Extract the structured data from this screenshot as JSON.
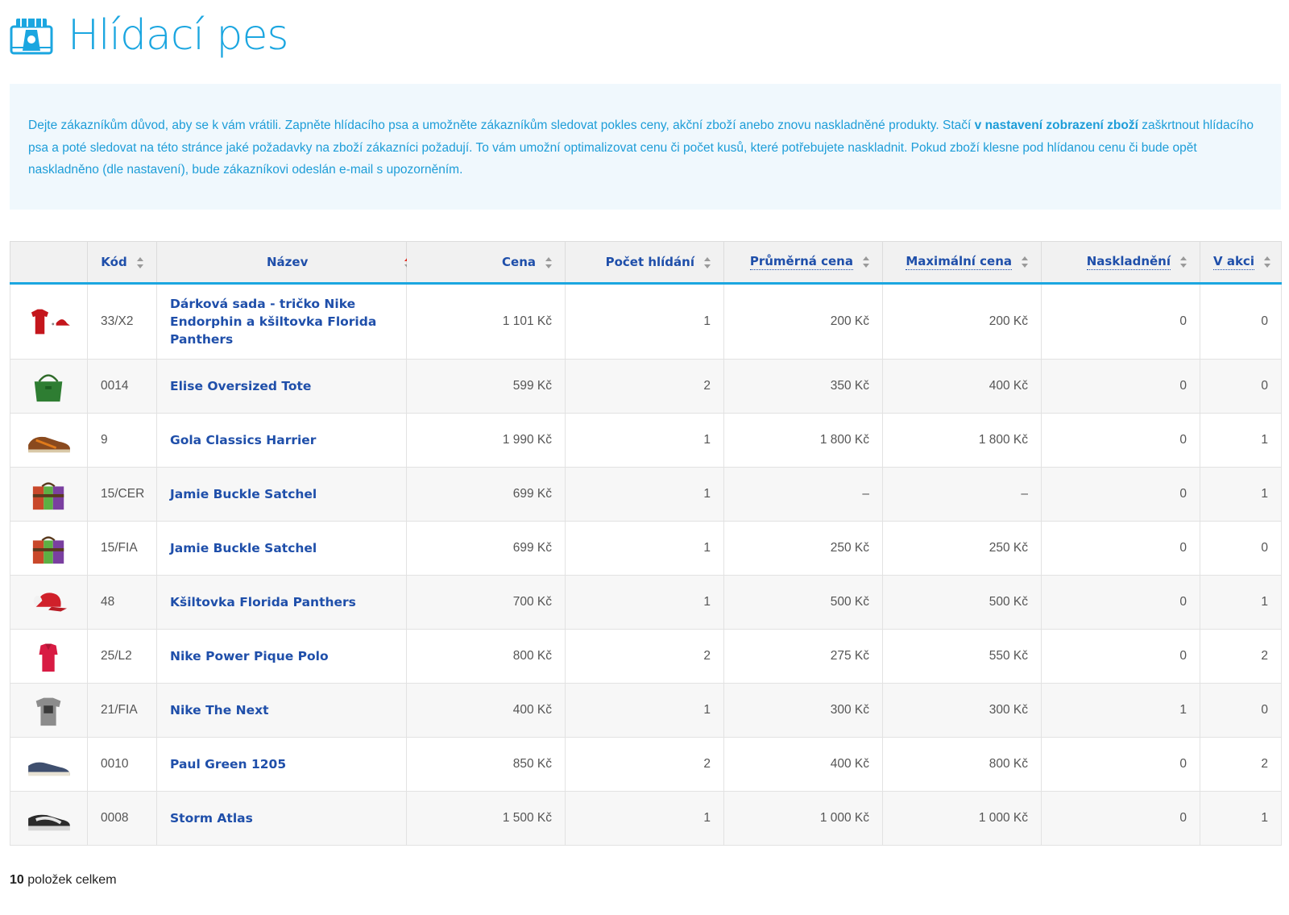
{
  "header": {
    "title": "Hlídací pes",
    "logo_icon": "watchdog-camera-icon"
  },
  "info": {
    "text_before": "Dejte zákazníkům důvod, aby se k vám vrátili. Zapněte hlídacího psa a umožněte zákazníkům sledovat pokles ceny, akční zboží anebo znovu naskladněné produkty. Stačí ",
    "link_text": "v nastavení zobrazení zboží",
    "text_after": " zaškrtnout hlídacího psa a poté sledovat na této stránce jaké požadavky na zboží zákazníci požadují. To vám umožní optimalizovat cenu či počet kusů, které potřebujete naskladnit. Pokud zboží klesne pod hlídanou cenu či bude opět naskladněno (dle nastavení), bude zákazníkovi odeslán e-mail s upozorněním."
  },
  "table": {
    "columns": {
      "code": "Kód",
      "name": "Název",
      "price": "Cena",
      "watch_count": "Počet hlídání",
      "avg_price": "Průměrná cena",
      "max_price": "Maximální cena",
      "restock": "Naskladnění",
      "on_sale": "V akci"
    },
    "rows": [
      {
        "thumb": "tshirt-cap-thumb-icon",
        "code": "33/X2",
        "name": "Dárková sada - tričko Nike Endorphin a kšiltovka Florida Panthers",
        "price": "1 101 Kč",
        "watch_count": "1",
        "avg_price": "200 Kč",
        "max_price": "200 Kč",
        "restock": "0",
        "on_sale": "0"
      },
      {
        "thumb": "green-tote-thumb-icon",
        "code": "0014",
        "name": "Elise Oversized Tote",
        "price": "599 Kč",
        "watch_count": "2",
        "avg_price": "350 Kč",
        "max_price": "400 Kč",
        "restock": "0",
        "on_sale": "0"
      },
      {
        "thumb": "brown-sneaker-thumb-icon",
        "code": "9",
        "name": "Gola Classics Harrier",
        "price": "1 990 Kč",
        "watch_count": "1",
        "avg_price": "1 800 Kč",
        "max_price": "1 800 Kč",
        "restock": "0",
        "on_sale": "1"
      },
      {
        "thumb": "satchel-thumb-icon",
        "code": "15/CER",
        "name": "Jamie Buckle Satchel",
        "price": "699 Kč",
        "watch_count": "1",
        "avg_price": "–",
        "max_price": "–",
        "restock": "0",
        "on_sale": "1"
      },
      {
        "thumb": "satchel-thumb-icon",
        "code": "15/FIA",
        "name": "Jamie Buckle Satchel",
        "price": "699 Kč",
        "watch_count": "1",
        "avg_price": "250 Kč",
        "max_price": "250 Kč",
        "restock": "0",
        "on_sale": "0"
      },
      {
        "thumb": "cap-thumb-icon",
        "code": "48",
        "name": "Kšiltovka Florida Panthers",
        "price": "700 Kč",
        "watch_count": "1",
        "avg_price": "500 Kč",
        "max_price": "500 Kč",
        "restock": "0",
        "on_sale": "1"
      },
      {
        "thumb": "polo-thumb-icon",
        "code": "25/L2",
        "name": "Nike Power Pique Polo",
        "price": "800 Kč",
        "watch_count": "2",
        "avg_price": "275 Kč",
        "max_price": "550 Kč",
        "restock": "0",
        "on_sale": "2"
      },
      {
        "thumb": "grey-tshirt-thumb-icon",
        "code": "21/FIA",
        "name": "Nike The Next",
        "price": "400 Kč",
        "watch_count": "1",
        "avg_price": "300 Kč",
        "max_price": "300 Kč",
        "restock": "1",
        "on_sale": "0"
      },
      {
        "thumb": "blue-shoe-thumb-icon",
        "code": "0010",
        "name": "Paul Green 1205",
        "price": "850 Kč",
        "watch_count": "2",
        "avg_price": "400 Kč",
        "max_price": "800 Kč",
        "restock": "0",
        "on_sale": "2"
      },
      {
        "thumb": "skate-shoe-thumb-icon",
        "code": "0008",
        "name": "Storm Atlas",
        "price": "1 500 Kč",
        "watch_count": "1",
        "avg_price": "1 000 Kč",
        "max_price": "1 000 Kč",
        "restock": "0",
        "on_sale": "1"
      }
    ]
  },
  "footer": {
    "count": "10",
    "label": " položek celkem"
  },
  "colors": {
    "accent": "#1ba6e0",
    "link": "#1f4faa",
    "info_bg": "#f0f8fd",
    "sort_active": "#e0281c"
  }
}
